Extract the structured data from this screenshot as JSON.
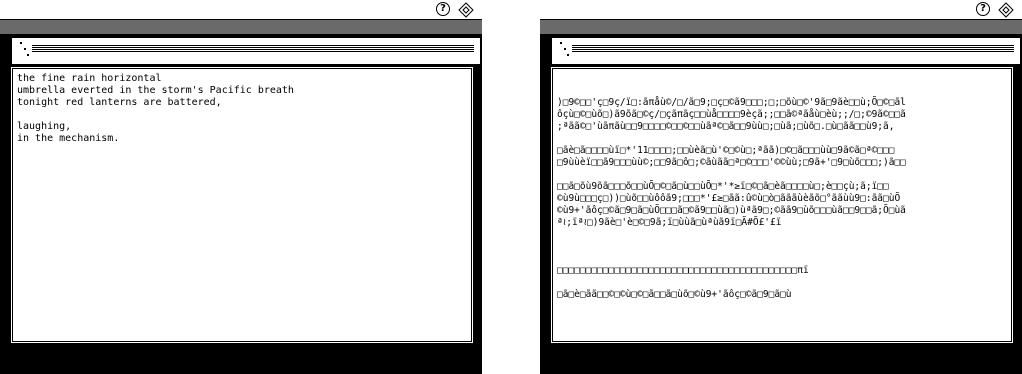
{
  "left_screen": {
    "menubar": {
      "apple_icon": "apple-icon",
      "help_icon": "help-icon",
      "app_icon": "app-icon",
      "help_glyph": "?"
    },
    "poem": [
      "the fine rain horizontal",
      "umbrella everted in the storm's Pacific breath",
      "tonight red lanterns are battered,",
      "",
      "laughing,",
      "in the mechanism."
    ]
  },
  "right_screen": {
    "menubar": {
      "apple_icon": "apple-icon",
      "help_icon": "help-icon",
      "app_icon": "app-icon",
      "help_glyph": "?"
    },
    "garbled": [
      "",
      "",
      ")□9©□□'ç□9ç/ï□:ãπåù©/□/ã□9;□ç□©ã9□□□;□;□õù□©'9ã□9ãè□□ù;Õ□©□ãl",
      "ôçù□©□ùõ□)ã9õã□©ç/□çãπãç□□ùå□□□□9èçã;;□□ã©ªãåù□èù;;/□;©9ã©□□ã",
      ";ªãã©□'ùãπãù□□9□□□□©□□©□□ùãª©□ã□□9ùù□;□ùã;□ùõ□.□ù□ãã□□ù9;ã,",
      "",
      "□ãè□ã□□□□ùï□*'11□□□□;□□ùèã□ù'©□©ù□;ªãã)□©□ã□□□ùù□9ã©ã□ª©□□□",
      "□9ùùèï□□ã9□□□ùù©;□□9ã□ô□;©ãùãã□ª□©□□□'©©ùù;□9ã+'□9□ùõ□□□;)ã□□",
      "",
      "□□ã□õù9õã□□□õ□□ùÕ□©□ã□ù□□ùÕ□*'*≥ï□©□ã□èã□□□□ù□;è□□çù;ã;ï□□",
      "©ù9ù□□□ç□))□ùõ□□ùôôã9;□□□*'£≥□ãã:û©ù□ò□ãããùèãõ□°ããùù9□:ãã□ùÕ",
      "©ù9+'ãôç□©ã□9□ã□ùÕ□□□ã□©ã9□□ùã□)ùªã9□;©ãã9□ùõ□□□ùã□□9□□ã;Õ□ùã",
      "ª≀;ïª≀□)9ãè□'è□©□9ã;ï□ùùã□ùªùã9ï□Ã#Õ£'£ï",
      "",
      "",
      "",
      "□□□□□□□□□□□□□□□□□□□□□□□□□□□□□□□□□□□□□□□□□□πï",
      "",
      "□ã□è□ãã□□©□©ù□©□ã□□ã□ùõ□©ù9+'ãôç□©ã□9□ã□ù"
    ]
  }
}
